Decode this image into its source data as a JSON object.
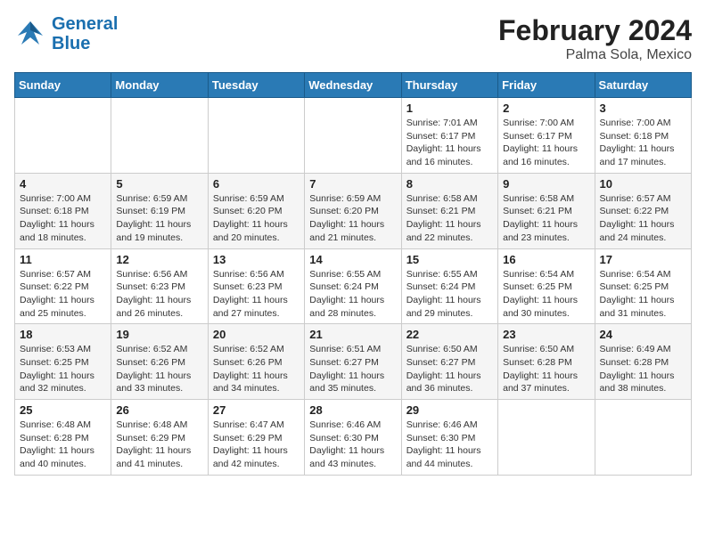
{
  "header": {
    "logo_line1": "General",
    "logo_line2": "Blue",
    "title": "February 2024",
    "subtitle": "Palma Sola, Mexico"
  },
  "weekdays": [
    "Sunday",
    "Monday",
    "Tuesday",
    "Wednesday",
    "Thursday",
    "Friday",
    "Saturday"
  ],
  "weeks": [
    [
      {
        "day": "",
        "info": ""
      },
      {
        "day": "",
        "info": ""
      },
      {
        "day": "",
        "info": ""
      },
      {
        "day": "",
        "info": ""
      },
      {
        "day": "1",
        "info": "Sunrise: 7:01 AM\nSunset: 6:17 PM\nDaylight: 11 hours and 16 minutes."
      },
      {
        "day": "2",
        "info": "Sunrise: 7:00 AM\nSunset: 6:17 PM\nDaylight: 11 hours and 16 minutes."
      },
      {
        "day": "3",
        "info": "Sunrise: 7:00 AM\nSunset: 6:18 PM\nDaylight: 11 hours and 17 minutes."
      }
    ],
    [
      {
        "day": "4",
        "info": "Sunrise: 7:00 AM\nSunset: 6:18 PM\nDaylight: 11 hours and 18 minutes."
      },
      {
        "day": "5",
        "info": "Sunrise: 6:59 AM\nSunset: 6:19 PM\nDaylight: 11 hours and 19 minutes."
      },
      {
        "day": "6",
        "info": "Sunrise: 6:59 AM\nSunset: 6:20 PM\nDaylight: 11 hours and 20 minutes."
      },
      {
        "day": "7",
        "info": "Sunrise: 6:59 AM\nSunset: 6:20 PM\nDaylight: 11 hours and 21 minutes."
      },
      {
        "day": "8",
        "info": "Sunrise: 6:58 AM\nSunset: 6:21 PM\nDaylight: 11 hours and 22 minutes."
      },
      {
        "day": "9",
        "info": "Sunrise: 6:58 AM\nSunset: 6:21 PM\nDaylight: 11 hours and 23 minutes."
      },
      {
        "day": "10",
        "info": "Sunrise: 6:57 AM\nSunset: 6:22 PM\nDaylight: 11 hours and 24 minutes."
      }
    ],
    [
      {
        "day": "11",
        "info": "Sunrise: 6:57 AM\nSunset: 6:22 PM\nDaylight: 11 hours and 25 minutes."
      },
      {
        "day": "12",
        "info": "Sunrise: 6:56 AM\nSunset: 6:23 PM\nDaylight: 11 hours and 26 minutes."
      },
      {
        "day": "13",
        "info": "Sunrise: 6:56 AM\nSunset: 6:23 PM\nDaylight: 11 hours and 27 minutes."
      },
      {
        "day": "14",
        "info": "Sunrise: 6:55 AM\nSunset: 6:24 PM\nDaylight: 11 hours and 28 minutes."
      },
      {
        "day": "15",
        "info": "Sunrise: 6:55 AM\nSunset: 6:24 PM\nDaylight: 11 hours and 29 minutes."
      },
      {
        "day": "16",
        "info": "Sunrise: 6:54 AM\nSunset: 6:25 PM\nDaylight: 11 hours and 30 minutes."
      },
      {
        "day": "17",
        "info": "Sunrise: 6:54 AM\nSunset: 6:25 PM\nDaylight: 11 hours and 31 minutes."
      }
    ],
    [
      {
        "day": "18",
        "info": "Sunrise: 6:53 AM\nSunset: 6:25 PM\nDaylight: 11 hours and 32 minutes."
      },
      {
        "day": "19",
        "info": "Sunrise: 6:52 AM\nSunset: 6:26 PM\nDaylight: 11 hours and 33 minutes."
      },
      {
        "day": "20",
        "info": "Sunrise: 6:52 AM\nSunset: 6:26 PM\nDaylight: 11 hours and 34 minutes."
      },
      {
        "day": "21",
        "info": "Sunrise: 6:51 AM\nSunset: 6:27 PM\nDaylight: 11 hours and 35 minutes."
      },
      {
        "day": "22",
        "info": "Sunrise: 6:50 AM\nSunset: 6:27 PM\nDaylight: 11 hours and 36 minutes."
      },
      {
        "day": "23",
        "info": "Sunrise: 6:50 AM\nSunset: 6:28 PM\nDaylight: 11 hours and 37 minutes."
      },
      {
        "day": "24",
        "info": "Sunrise: 6:49 AM\nSunset: 6:28 PM\nDaylight: 11 hours and 38 minutes."
      }
    ],
    [
      {
        "day": "25",
        "info": "Sunrise: 6:48 AM\nSunset: 6:28 PM\nDaylight: 11 hours and 40 minutes."
      },
      {
        "day": "26",
        "info": "Sunrise: 6:48 AM\nSunset: 6:29 PM\nDaylight: 11 hours and 41 minutes."
      },
      {
        "day": "27",
        "info": "Sunrise: 6:47 AM\nSunset: 6:29 PM\nDaylight: 11 hours and 42 minutes."
      },
      {
        "day": "28",
        "info": "Sunrise: 6:46 AM\nSunset: 6:30 PM\nDaylight: 11 hours and 43 minutes."
      },
      {
        "day": "29",
        "info": "Sunrise: 6:46 AM\nSunset: 6:30 PM\nDaylight: 11 hours and 44 minutes."
      },
      {
        "day": "",
        "info": ""
      },
      {
        "day": "",
        "info": ""
      }
    ]
  ]
}
